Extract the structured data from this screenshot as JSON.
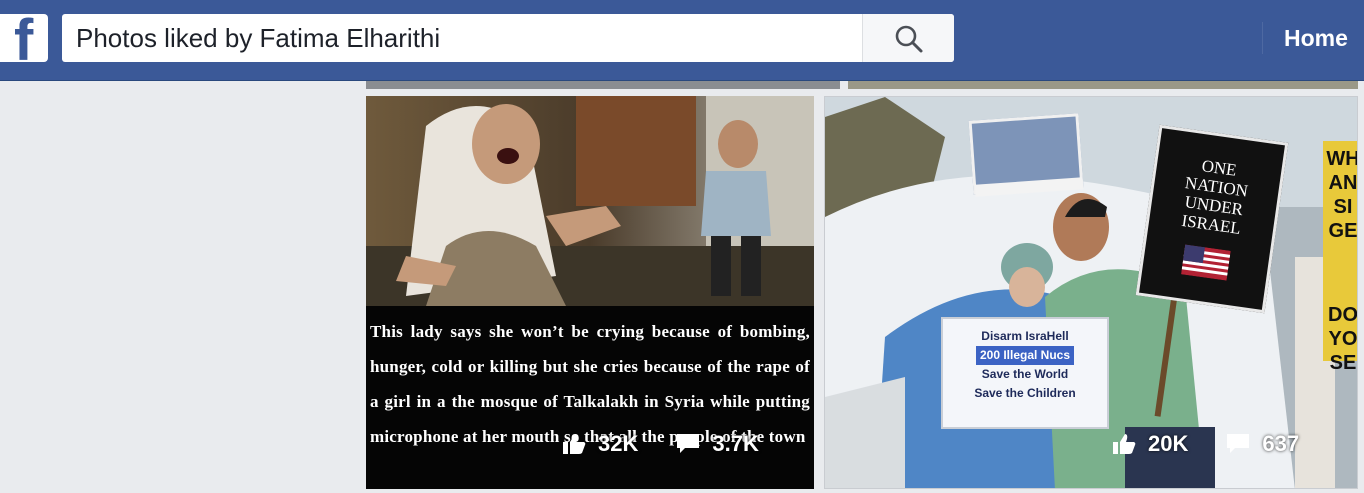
{
  "header": {
    "search_value": "Photos liked by Fatima Elharithi",
    "home_label": "Home",
    "logo_letter": "f",
    "search_icon": "search-icon",
    "brand_color": "#3b5998"
  },
  "photos": [
    {
      "caption": "This lady says she won’t be crying because of bombing, hunger, cold or killing but she cries because of the rape of a girl in a the mosque of Talkalakh in Syria while putting microphone at her mouth so that all the people of the town",
      "likes": "32K",
      "comments": "3.7K"
    },
    {
      "sign_main": [
        "Disarm IsraHell",
        "200 Illegal Nucs",
        "Save the World",
        "Save the Children"
      ],
      "sign_one": [
        "ONE",
        "NATION",
        "UNDER",
        "ISRAEL"
      ],
      "sign_side": [
        "WH",
        "AN",
        "SI",
        "GE",
        "DO",
        "YO",
        "SE"
      ],
      "likes": "20K",
      "comments": "637"
    }
  ]
}
